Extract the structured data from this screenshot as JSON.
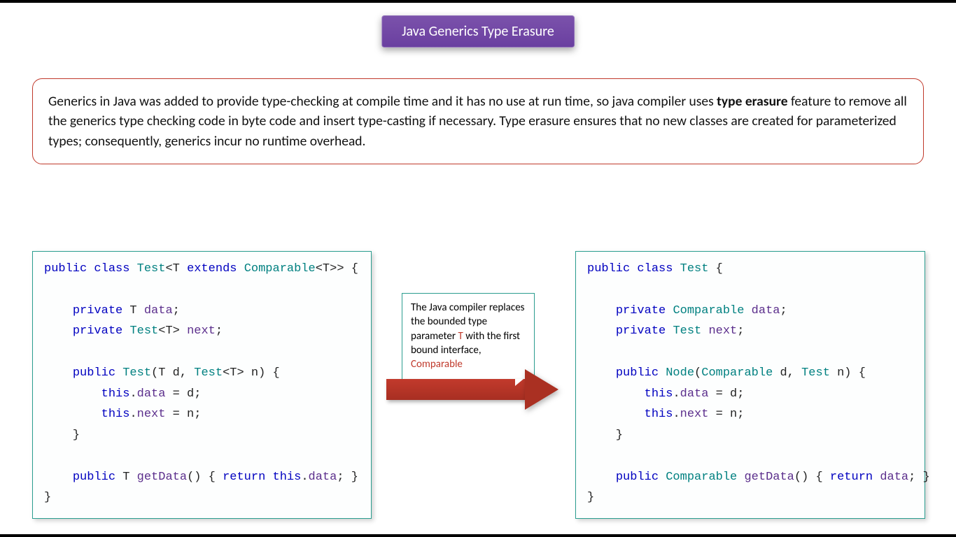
{
  "title": "Java Generics Type Erasure",
  "intro": {
    "pre": "Generics in Java was added to provide type-checking at compile time and it has no use at run time, so java compiler uses ",
    "bold": "type erasure",
    "post": " feature to remove all the generics type checking code in byte code and insert type-casting if necessary. Type erasure ensures that no new classes are created for parameterized types; consequently, generics incur no runtime overhead."
  },
  "callout": {
    "l1": "The Java compiler replaces the bounded type parameter ",
    "t": "T",
    "l2": " with the first bound interface, ",
    "c": "Comparable"
  },
  "code_left": {
    "l1a": "public",
    "l1b": "class",
    "l1c": "Test",
    "l1d": "extends",
    "l1e": "Comparable",
    "l2a": "private",
    "l2b": "data",
    "l3a": "private",
    "l3b": "Test",
    "l3c": "next",
    "l4a": "public",
    "l4b": "Test",
    "l4c": "Test",
    "l5a": "this",
    "l5b": "data",
    "l6a": "this",
    "l6b": "next",
    "l7a": "public",
    "l7b": "getData",
    "l7c": "return",
    "l7d": "this",
    "l7e": "data"
  },
  "code_right": {
    "l1a": "public",
    "l1b": "class",
    "l1c": "Test",
    "l2a": "private",
    "l2b": "Comparable",
    "l2c": "data",
    "l3a": "private",
    "l3b": "Test",
    "l3c": "next",
    "l4a": "public",
    "l4b": "Node",
    "l4c": "Comparable",
    "l4d": "Test",
    "l5a": "this",
    "l5b": "data",
    "l6a": "this",
    "l6b": "next",
    "l7a": "public",
    "l7b": "Comparable",
    "l7c": "getData",
    "l7d": "return",
    "l7e": "data"
  }
}
